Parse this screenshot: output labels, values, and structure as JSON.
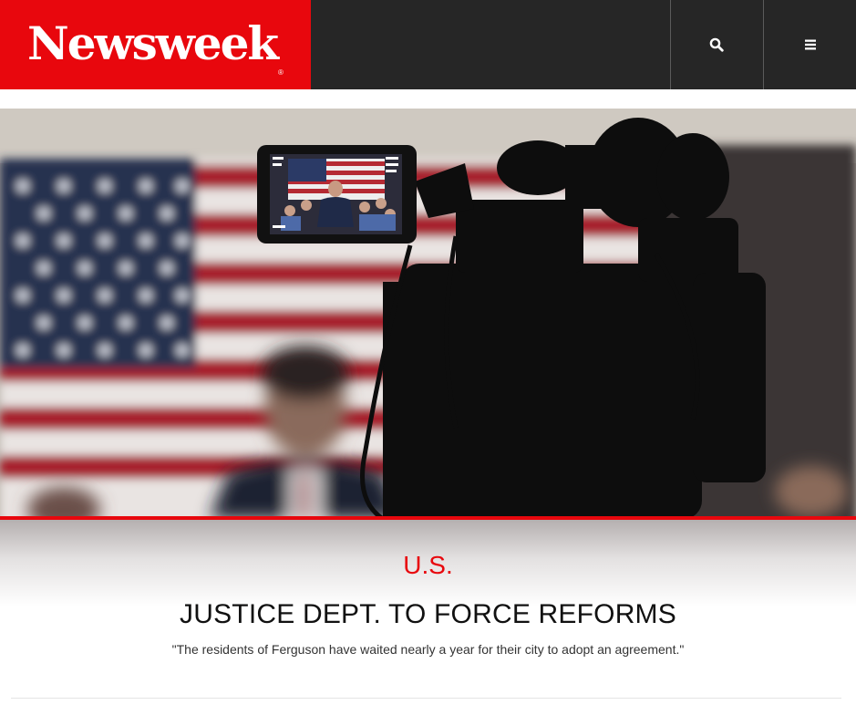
{
  "header": {
    "logo_text": "Newsweek",
    "logo_mark": "®",
    "brand_color": "#e8070d",
    "bar_color": "#262626",
    "search_icon": "search-icon",
    "menu_icon": "hamburger-menu-icon"
  },
  "hero": {
    "image_description_icon": "photo"
  },
  "article": {
    "section": "U.S.",
    "headline": "JUSTICE DEPT. TO FORCE REFORMS",
    "dek": "\"The residents of Ferguson have waited nearly a year for their city to adopt an agreement.\""
  }
}
